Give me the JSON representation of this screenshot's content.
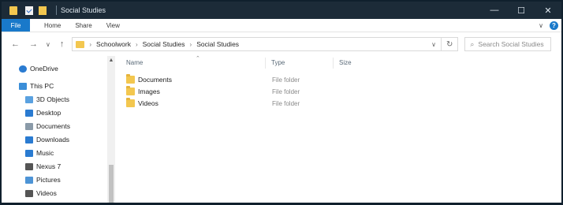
{
  "window": {
    "title": "Social Studies",
    "minimize_icon": "—",
    "maximize_icon": "☐",
    "close_icon": "✕"
  },
  "ribbon": {
    "tabs": [
      "File",
      "Home",
      "Share",
      "View"
    ],
    "expand_icon": "∨",
    "help_icon": "?"
  },
  "nav_buttons": {
    "back": "←",
    "forward": "→",
    "recent": "∨",
    "up": "↑"
  },
  "address": {
    "breadcrumb": [
      "Schoolwork",
      "Social Studies",
      "Social Studies"
    ],
    "separator": "›",
    "dropdown_icon": "∨",
    "refresh_icon": "↻"
  },
  "search": {
    "placeholder": "Search Social Studies",
    "icon": "⌕"
  },
  "sidebar": {
    "items": [
      {
        "label": "OneDrive",
        "icon": "cloud-icon",
        "color": "#2a7bd1"
      },
      {
        "label": "This PC",
        "icon": "computer-icon",
        "color": "#3b8ed8"
      },
      {
        "label": "3D Objects",
        "icon": "cube-icon",
        "color": "#5aa1e0"
      },
      {
        "label": "Desktop",
        "icon": "desktop-icon",
        "color": "#2a7bd1"
      },
      {
        "label": "Documents",
        "icon": "document-icon",
        "color": "#8a9aa8"
      },
      {
        "label": "Downloads",
        "icon": "download-icon",
        "color": "#2a7bd1"
      },
      {
        "label": "Music",
        "icon": "music-icon",
        "color": "#2a7bd1"
      },
      {
        "label": "Nexus 7",
        "icon": "device-icon",
        "color": "#555555"
      },
      {
        "label": "Pictures",
        "icon": "pictures-icon",
        "color": "#4d94d6"
      },
      {
        "label": "Videos",
        "icon": "video-icon",
        "color": "#555555"
      }
    ]
  },
  "file_list": {
    "columns": [
      "Name",
      "Type",
      "Size"
    ],
    "rows": [
      {
        "name": "Documents",
        "type": "File folder"
      },
      {
        "name": "Images",
        "type": "File folder"
      },
      {
        "name": "Videos",
        "type": "File folder"
      }
    ]
  },
  "colors": {
    "file_tab": "#1979ca",
    "folder": "#f3c74f",
    "titlebar": "#1c2b38"
  }
}
